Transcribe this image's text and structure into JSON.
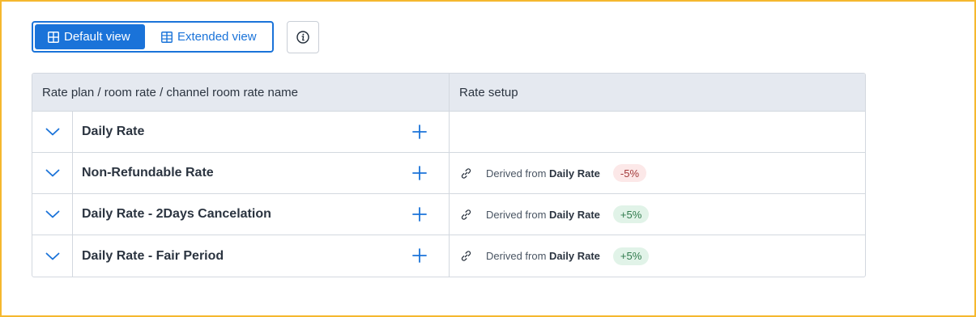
{
  "toolbar": {
    "default_view_label": "Default view",
    "extended_view_label": "Extended view",
    "active_view": "default"
  },
  "table": {
    "headers": {
      "name": "Rate plan / room rate / channel room rate name",
      "setup": "Rate setup"
    },
    "rows": [
      {
        "name": "Daily Rate",
        "derived_prefix": "",
        "derived_source": "",
        "adjustment": ""
      },
      {
        "name": "Non-Refundable Rate",
        "derived_prefix": "Derived from",
        "derived_source": "Daily Rate",
        "adjustment": "-5%"
      },
      {
        "name": "Daily Rate - 2Days Cancelation",
        "derived_prefix": "Derived from",
        "derived_source": "Daily Rate",
        "adjustment": "+5%"
      },
      {
        "name": "Daily Rate - Fair Period",
        "derived_prefix": "Derived from",
        "derived_source": "Daily Rate",
        "adjustment": "+5%"
      }
    ]
  },
  "colors": {
    "accent": "#1a73d9",
    "negative_badge_bg": "#fce8e8",
    "positive_badge_bg": "#e1f3e8",
    "header_bg": "#e5e9f0"
  },
  "icons": [
    "grid-icon",
    "extended-grid-icon",
    "info-icon",
    "chevron-down-icon",
    "plus-icon",
    "link-icon"
  ]
}
